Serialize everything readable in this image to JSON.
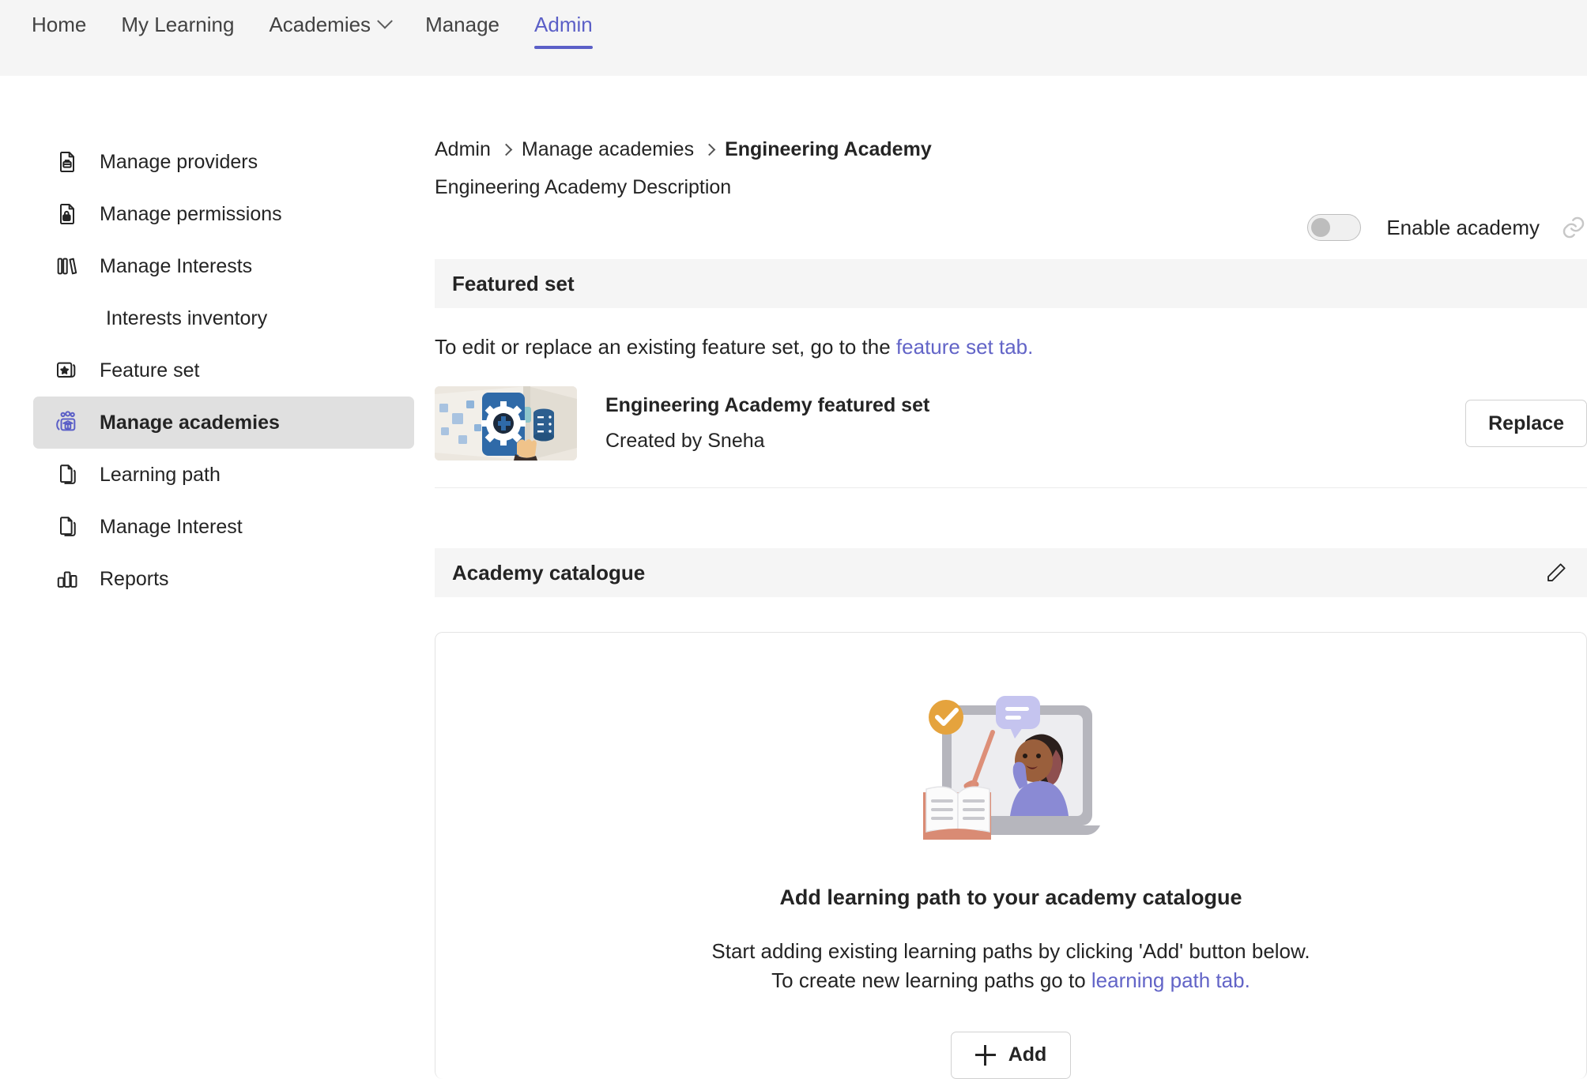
{
  "topnav": {
    "items": [
      {
        "label": "Home",
        "active": false,
        "has_chevron": false
      },
      {
        "label": "My Learning",
        "active": false,
        "has_chevron": false
      },
      {
        "label": "Academies",
        "active": false,
        "has_chevron": true
      },
      {
        "label": "Manage",
        "active": false,
        "has_chevron": false
      },
      {
        "label": "Admin",
        "active": true,
        "has_chevron": false
      }
    ],
    "active_color": "#5b5fc7"
  },
  "sidebar": {
    "items": [
      {
        "label": "Manage providers",
        "icon": "document-toolbox-icon",
        "selected": false,
        "sub": false
      },
      {
        "label": "Manage permissions",
        "icon": "document-lock-icon",
        "selected": false,
        "sub": false
      },
      {
        "label": "Manage Interests",
        "icon": "books-icon",
        "selected": false,
        "sub": false
      },
      {
        "label": "Interests inventory",
        "icon": "none",
        "selected": false,
        "sub": true
      },
      {
        "label": "Feature set",
        "icon": "star-stack-icon",
        "selected": false,
        "sub": false
      },
      {
        "label": "Manage academies",
        "icon": "people-academy-icon",
        "selected": true,
        "sub": false
      },
      {
        "label": "Learning path",
        "icon": "document-copy-icon",
        "selected": false,
        "sub": false
      },
      {
        "label": "Manage Interest",
        "icon": "document-copy-icon",
        "selected": false,
        "sub": false
      },
      {
        "label": "Reports",
        "icon": "bar-chart-icon",
        "selected": false,
        "sub": false
      }
    ]
  },
  "breadcrumb": {
    "root": "Admin",
    "parent": "Manage academies",
    "current": "Engineering Academy"
  },
  "page": {
    "description": "Engineering Academy Description"
  },
  "enable_toggle": {
    "label": "Enable academy",
    "state_on": false,
    "link_icon": "link-icon"
  },
  "featured_set": {
    "section_title": "Featured set",
    "helper_prefix": "To edit or replace an existing feature set, go to the ",
    "helper_link": "feature set tab.",
    "item_title": "Engineering Academy featured set",
    "item_subtitle": "Created by Sneha",
    "replace_label": "Replace",
    "thumbnail": "engineering-gear-database-illustration"
  },
  "academy_catalogue": {
    "section_title": "Academy catalogue",
    "edit_icon": "pencil-edit-icon",
    "empty_state": {
      "illustration": "teacher-laptop-book-illustration",
      "title": "Add learning path to your academy catalogue",
      "line1": "Start adding existing learning paths by clicking 'Add' button below.",
      "line2_prefix": "To create new learning paths go to ",
      "line2_link": "learning path tab.",
      "add_label": "Add"
    }
  },
  "colors": {
    "accent": "#5b5fc7",
    "link": "#6264c7",
    "section_bg": "#f5f5f5",
    "selected_bg": "#e0e0e0"
  }
}
